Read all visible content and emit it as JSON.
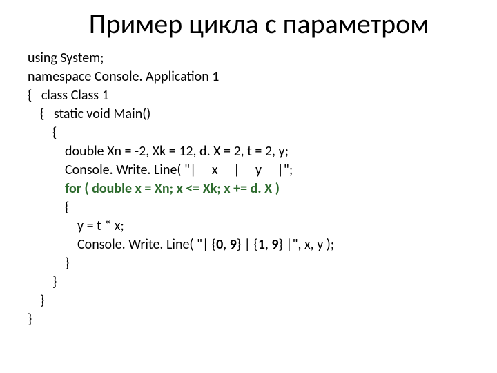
{
  "title": "Пример цикла с параметром",
  "code": {
    "l01": "using System;",
    "l02": "namespace Console. Application 1",
    "l03": "{   class Class 1",
    "l04": "{   static void Main()",
    "l05": "{",
    "l06": "double Xn = -2, Xk = 12, d. X = 2, t = 2, y;",
    "l07": "Console. Write. Line( \"|     x     |     y     |\";",
    "l08": "for ( double x = Xn; x <= Xk; x += d. X )",
    "l09": "{",
    "l10": "y = t * x;",
    "fmt0": "0",
    "fmt0w": "9",
    "fmt1": "1",
    "fmt1w": "9",
    "l12": "}",
    "l13": "}",
    "l14": "}",
    "l15": "}"
  }
}
